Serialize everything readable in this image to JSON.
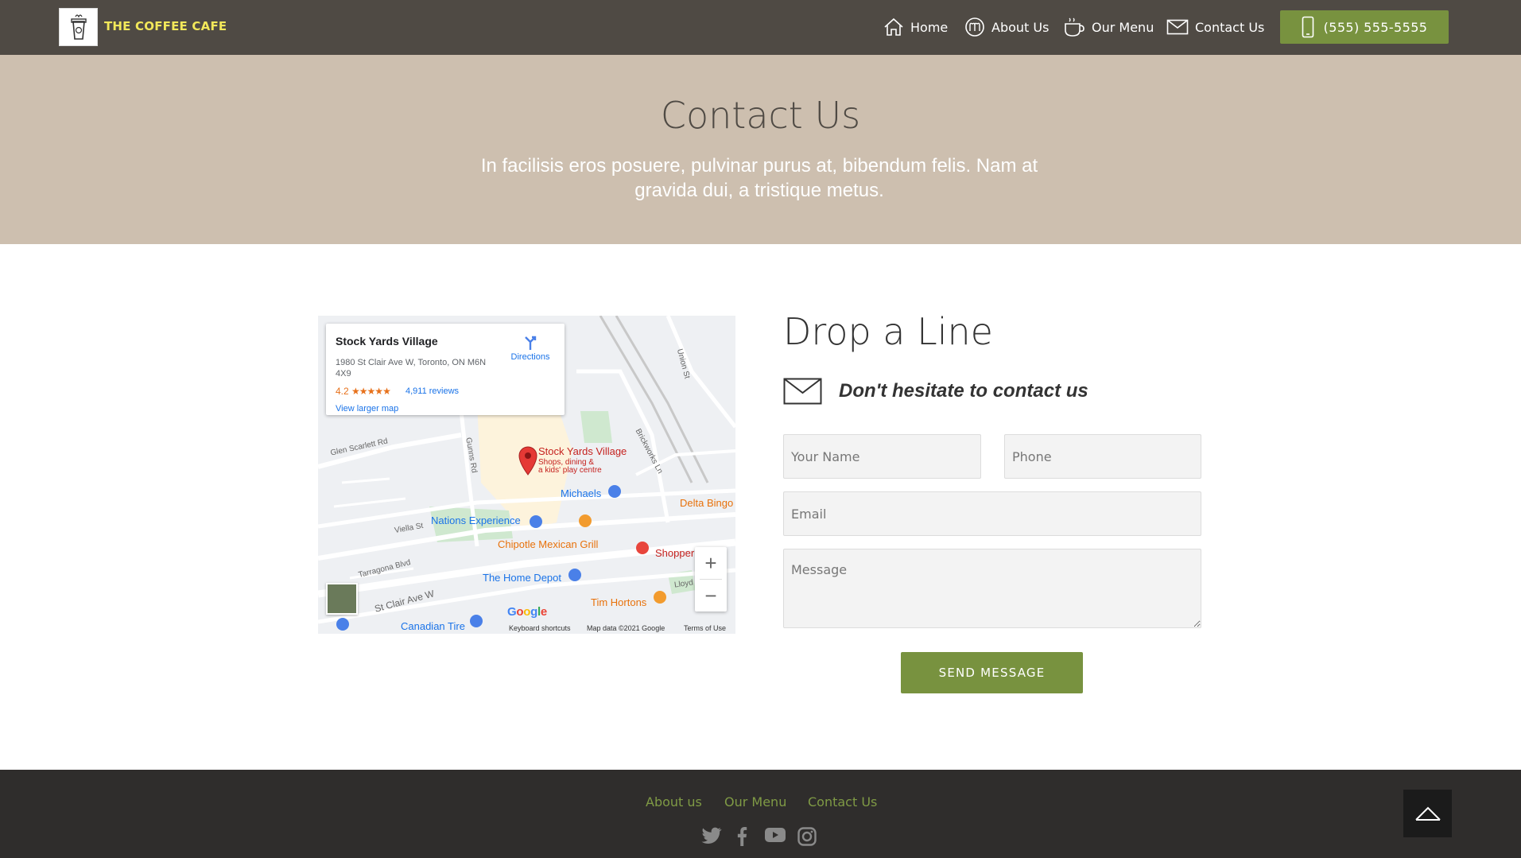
{
  "header": {
    "brand": "THE COFFEE CAFE",
    "nav": [
      {
        "label": "Home",
        "icon": "home-icon"
      },
      {
        "label": "About Us",
        "icon": "about-icon"
      },
      {
        "label": "Our Menu",
        "icon": "coffee-cup-icon"
      },
      {
        "label": "Contact Us",
        "icon": "envelope-icon"
      }
    ],
    "phone": "(555) 555-5555"
  },
  "hero": {
    "title": "Contact Us",
    "subtitle": "In facilisis eros posuere, pulvinar purus at, bibendum felis. Nam at gravida dui, a tristique metus."
  },
  "map": {
    "place_name": "Stock Yards Village",
    "address": "1980 St Clair Ave W, Toronto, ON M6N 4X9",
    "rating": "4.2",
    "stars": "★★★★★",
    "reviews": "4,911 reviews",
    "view_larger": "View larger map",
    "directions": "Directions",
    "pin_title": "Stock Yards Village",
    "pin_sub1": "Shops, dining &",
    "pin_sub2": "a kids' play centre",
    "places": {
      "michaels": "Michaels",
      "delta_bingo": "Delta Bingo",
      "nations": "Nations Experience",
      "chipotle": "Chipotle Mexican Grill",
      "shoppers": "Shopper",
      "home_depot": "The Home Depot",
      "tim_hortons": "Tim Hortons",
      "canadian_tire": "Canadian Tire"
    },
    "streets": {
      "glen_scarlett": "Glen Scarlett Rd",
      "gunns": "Gunns Rd",
      "union": "Union St",
      "brickworks": "Brickworks Ln",
      "viella": "Viella St",
      "tarragona": "Tarragona Blvd",
      "st_clair": "St Clair Ave W",
      "lloyd": "Lloyd"
    },
    "zoom_in": "+",
    "zoom_out": "−",
    "google": "Google",
    "keyboard": "Keyboard shortcuts",
    "map_data": "Map data ©2021 Google",
    "terms": "Terms of Use"
  },
  "form": {
    "title": "Drop a Line",
    "subtitle": "Don't hesitate to contact us",
    "name_placeholder": "Your Name",
    "phone_placeholder": "Phone",
    "email_placeholder": "Email",
    "message_placeholder": "Message",
    "send_label": "SEND MESSAGE"
  },
  "footer": {
    "links": [
      "About us",
      "Our Menu",
      "Contact Us"
    ],
    "social": [
      "twitter-icon",
      "facebook-icon",
      "youtube-icon",
      "instagram-icon"
    ]
  },
  "colors": {
    "header_bg": "#4f4a44",
    "hero_bg": "#cdbfaf",
    "accent_green": "#78923f",
    "brand_yellow": "#f2e85a",
    "footer_bg": "#2f2d2c"
  }
}
